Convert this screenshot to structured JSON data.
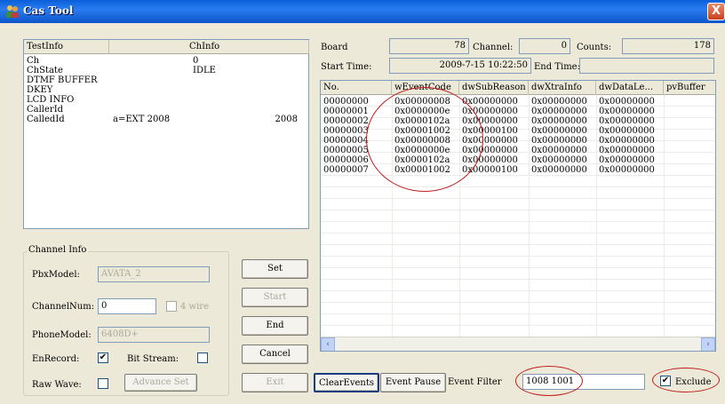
{
  "window": {
    "title": "Cas Tool",
    "close_glyph": "X"
  },
  "info_list": {
    "headers": [
      "TestInfo",
      "ChInfo"
    ],
    "rows": [
      {
        "label": "Ch",
        "value": "0",
        "extra": ""
      },
      {
        "label": "ChState",
        "value": "IDLE",
        "extra": ""
      },
      {
        "label": "DTMF BUFFER",
        "value": "",
        "extra": ""
      },
      {
        "label": "DKEY",
        "value": "",
        "extra": ""
      },
      {
        "label": "LCD INFO",
        "value": "",
        "extra": ""
      },
      {
        "label": "CallerId",
        "value": "",
        "extra": ""
      },
      {
        "label": "CalledId",
        "value": "a=EXT 2008",
        "extra": "2008"
      }
    ]
  },
  "channel_info": {
    "group_title": "Channel Info",
    "pbx_model_label": "PbxModel:",
    "pbx_model_value": "AVATA_2",
    "channel_num_label": "ChannelNum:",
    "channel_num_value": "0",
    "four_wire_label": "4 wire",
    "phone_model_label": "PhoneModel:",
    "phone_model_value": "6408D+",
    "en_record_label": "EnRecord:",
    "en_record_checked": "✔",
    "bit_stream_label": "Bit Stream:",
    "raw_wave_label": "Raw Wave:",
    "advance_set_label": "Advance Set"
  },
  "buttons": {
    "set": "Set",
    "start": "Start",
    "end": "End",
    "cancel": "Cancel",
    "exit": "Exit"
  },
  "top_fields": {
    "board_label": "Board",
    "board_value": "78",
    "channel_label": "Channel:",
    "channel_value": "0",
    "counts_label": "Counts:",
    "counts_value": "178",
    "start_time_label": "Start Time:",
    "start_time_value": "2009-7-15 10:22:50",
    "end_time_label": "End Time:",
    "end_time_value": ""
  },
  "event_list": {
    "headers": [
      "No.",
      "wEventCode",
      "dwSubReason",
      "dwXtraInfo",
      "dwDataLe...",
      "pvBuffer"
    ],
    "rows": [
      [
        "00000000",
        "0x00000008",
        "0x00000000",
        "0x00000000",
        "0x00000000"
      ],
      [
        "00000001",
        "0x0000000e",
        "0x00000000",
        "0x00000000",
        "0x00000000"
      ],
      [
        "00000002",
        "0x0000102a",
        "0x00000000",
        "0x00000000",
        "0x00000000"
      ],
      [
        "00000003",
        "0x00001002",
        "0x00000100",
        "0x00000000",
        "0x00000000"
      ],
      [
        "00000004",
        "0x00000008",
        "0x00000000",
        "0x00000000",
        "0x00000000"
      ],
      [
        "00000005",
        "0x0000000e",
        "0x00000000",
        "0x00000000",
        "0x00000000"
      ],
      [
        "00000006",
        "0x0000102a",
        "0x00000000",
        "0x00000000",
        "0x00000000"
      ],
      [
        "00000007",
        "0x00001002",
        "0x00000100",
        "0x00000000",
        "0x00000000"
      ]
    ]
  },
  "bottom_bar": {
    "clear_events": "ClearEvents",
    "event_pause": "Event Pause",
    "event_filter_label": "Event Filter",
    "event_filter_value": "1008 1001",
    "exclude_label": "Exclude",
    "exclude_checked": "✔"
  },
  "icons": {
    "scroll_left": "‹",
    "scroll_right": "›",
    "app_icon": "users-icon"
  },
  "colors": {
    "title_bar": "#0a5fd8",
    "annotation": "#c21a1a",
    "panel": "#ece9d8"
  }
}
